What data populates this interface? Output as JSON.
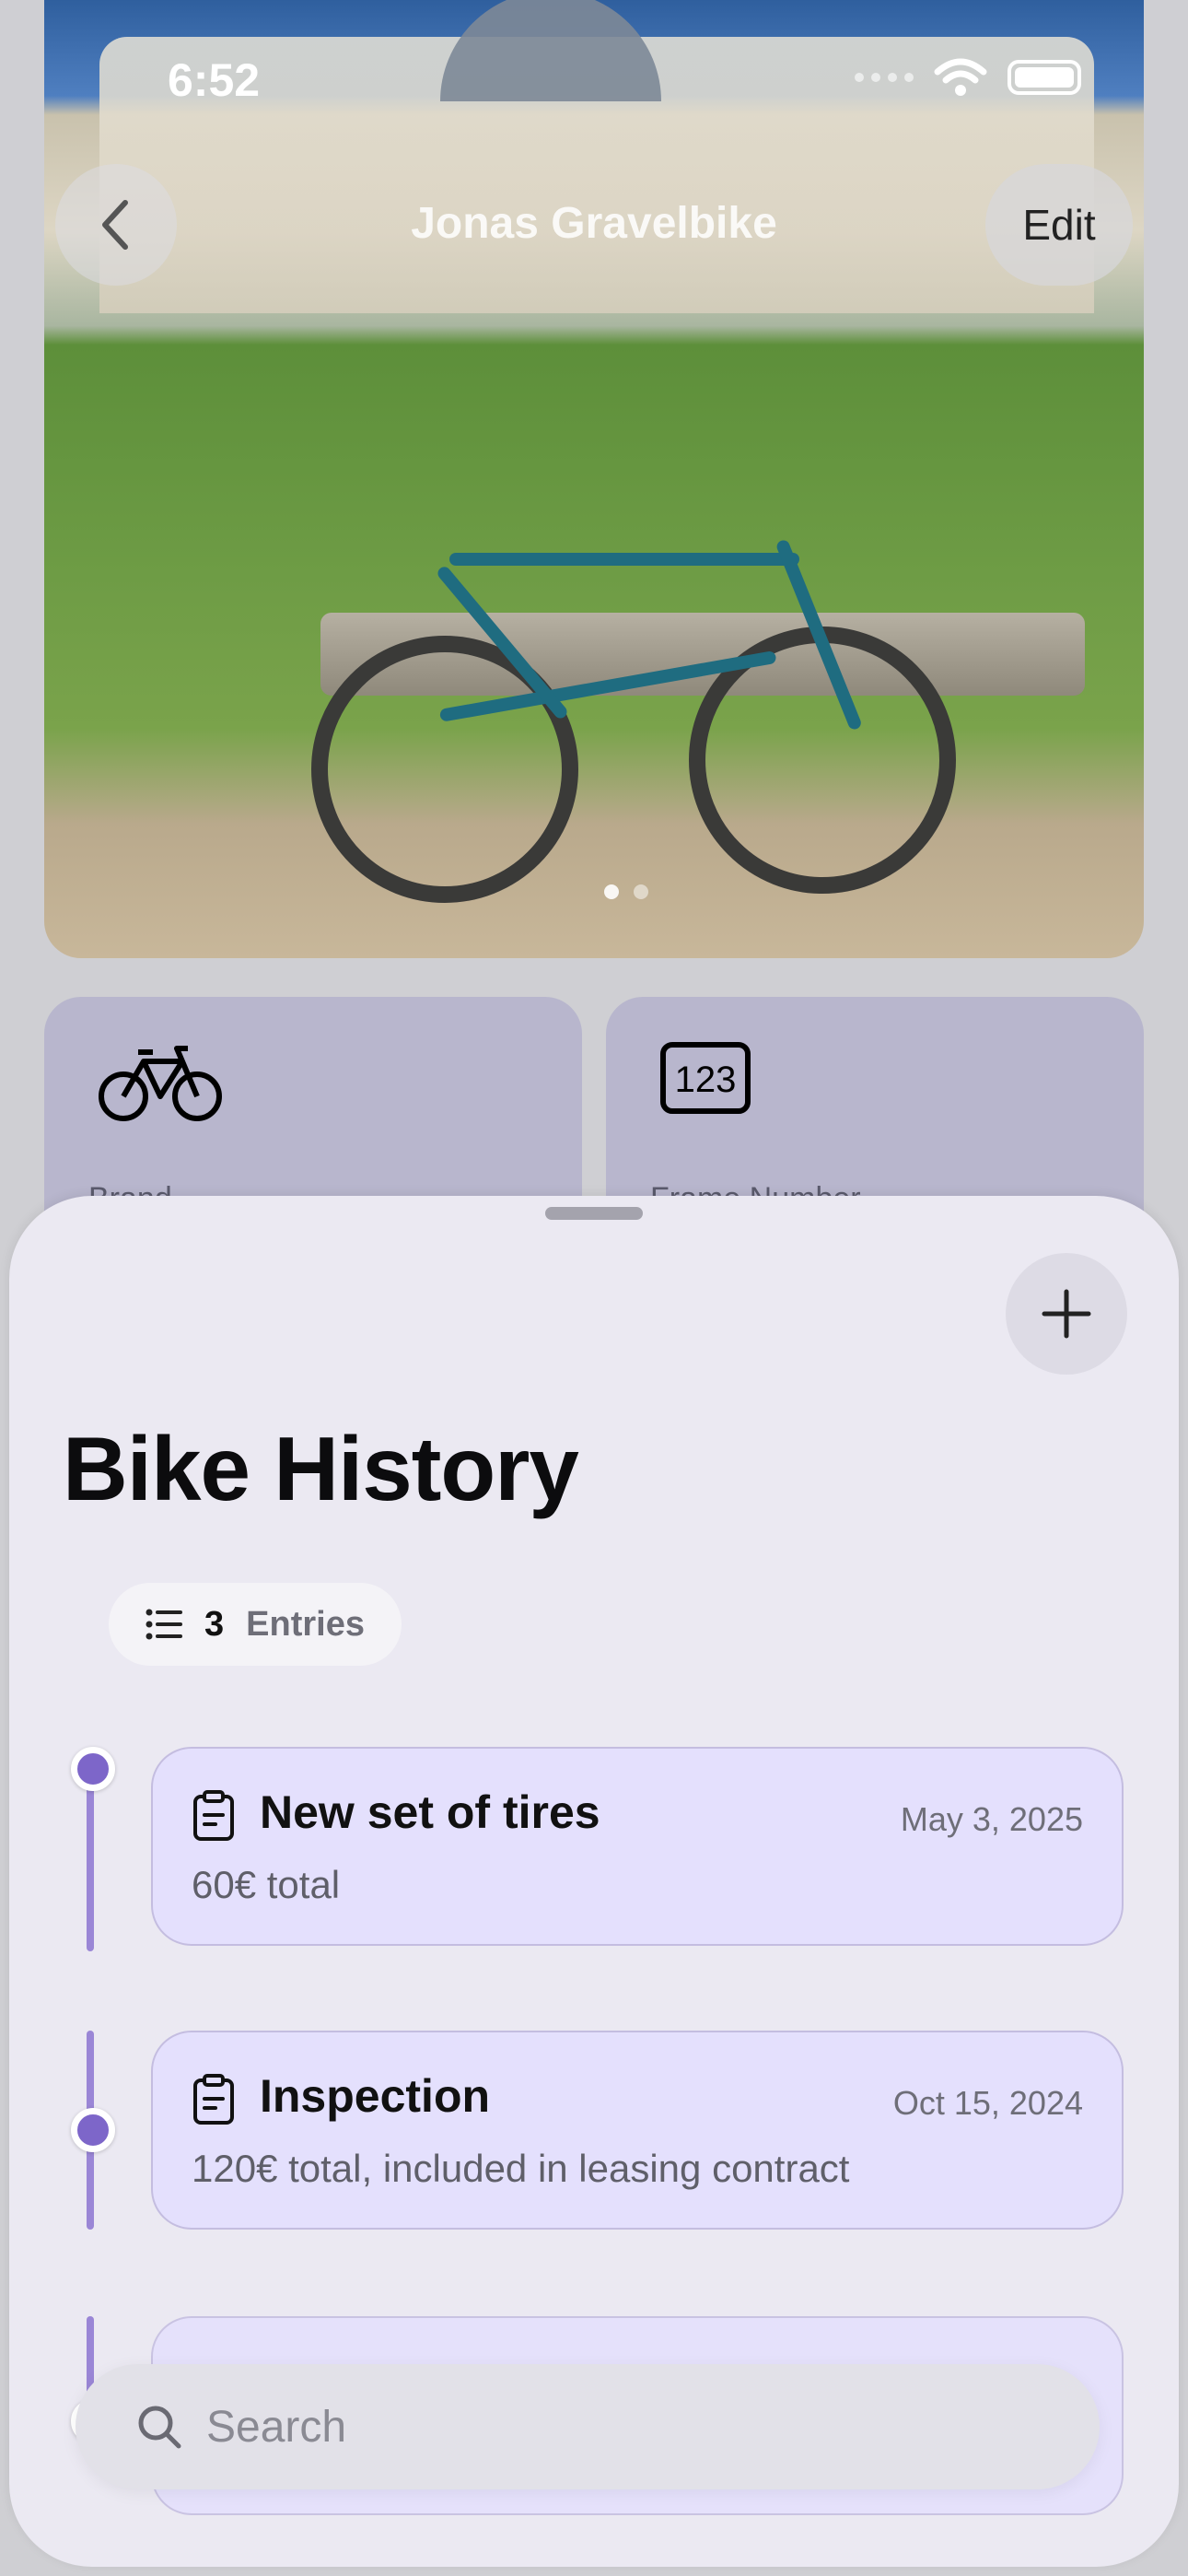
{
  "status_bar": {
    "time": "6:52"
  },
  "nav": {
    "title": "Jonas Gravelbike",
    "edit_label": "Edit"
  },
  "cards": [
    {
      "icon": "bicycle-icon",
      "label": "Brand"
    },
    {
      "icon": "number-123-icon",
      "label": "Frame Number"
    }
  ],
  "sheet": {
    "title": "Bike History",
    "entries_count": "3",
    "entries_label": "Entries"
  },
  "history": [
    {
      "icon": "clipboard-icon",
      "title": "New set of tires",
      "date": "May 3, 2025",
      "description": "60€ total"
    },
    {
      "icon": "clipboard-icon",
      "title": "Inspection",
      "date": "Oct 15, 2024",
      "description": "120€ total, included in leasing contract"
    }
  ],
  "search": {
    "placeholder": "Search"
  },
  "colors": {
    "accent": "#7d66c9",
    "entry_bg": "#e4e0fd",
    "sheet_bg": "#ebe9f2"
  }
}
